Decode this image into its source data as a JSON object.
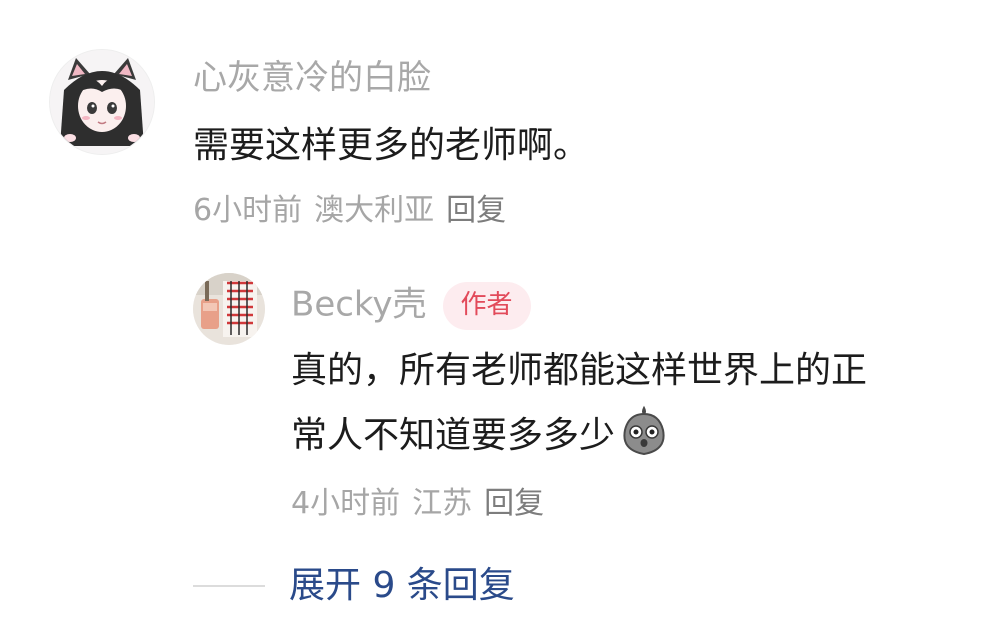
{
  "comment": {
    "username": "心灰意冷的白脸",
    "text": "需要这样更多的老师啊。",
    "time": "6小时前",
    "location": "澳大利亚",
    "reply_label": "回复",
    "avatar_icon": "anime-cat-girl-avatar"
  },
  "reply": {
    "username": "Becky壳",
    "badge": "作者",
    "text_line1": "真的，所有老师都能这样世界上的正",
    "text_line2": "常人不知道要多多少",
    "emoji_icon": "surprised-bird-emoji",
    "time": "4小时前",
    "location": "江苏",
    "reply_label": "回复",
    "avatar_icon": "photo-avatar"
  },
  "expand_replies": {
    "label": "展开 9 条回复"
  },
  "colors": {
    "username": "#a8a8a8",
    "content": "#1c1c1c",
    "meta": "#a6a6a6",
    "badge_bg": "#fdecef",
    "badge_text": "#e24a5a",
    "expand_link": "#2a4a8a"
  }
}
